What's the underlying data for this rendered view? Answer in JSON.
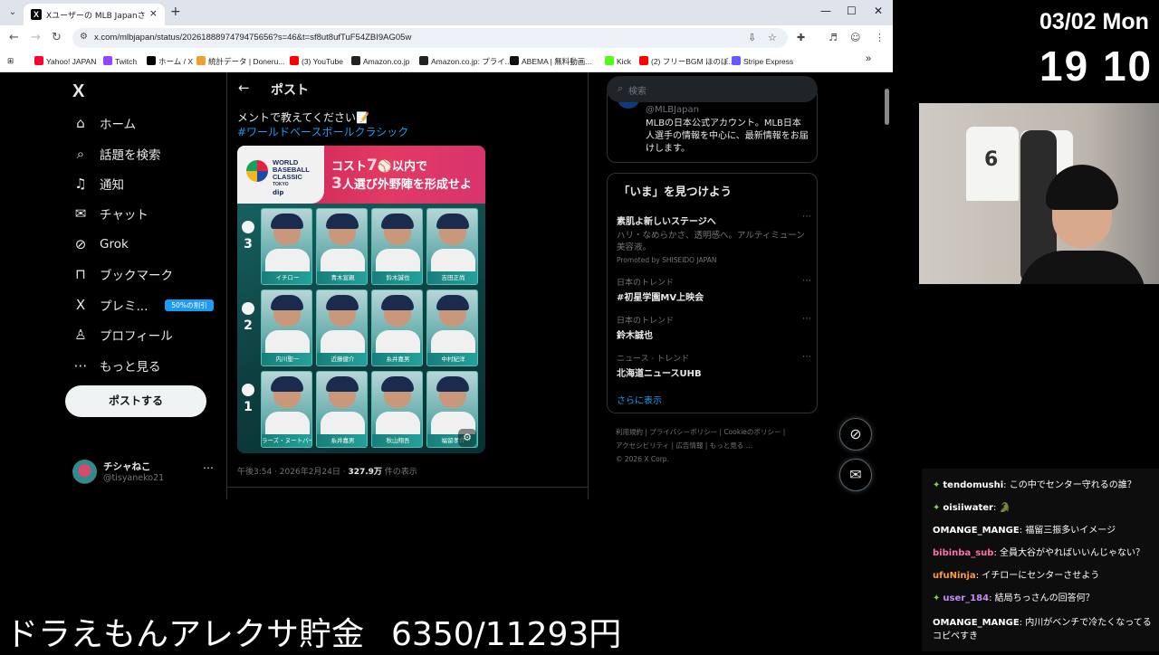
{
  "browser": {
    "tab_title": "Xユーザーの MLB Japanさん: 「誰を",
    "url": "x.com/mlbjapan/status/2026188897479475656?s=46&t=sf8ut8ufTuF54ZBI9AG05w",
    "bookmarks": [
      {
        "label": "Yahoo! JAPAN",
        "color": "#ff0033"
      },
      {
        "label": "Twitch",
        "color": "#9146ff"
      },
      {
        "label": "ホーム / X",
        "color": "#000000"
      },
      {
        "label": "統計データ | Doneru...",
        "color": "#f0a030"
      },
      {
        "label": "(3) YouTube",
        "color": "#ff0000"
      },
      {
        "label": "Amazon.co.jp",
        "color": "#222222"
      },
      {
        "label": "Amazon.co.jp: プライ...",
        "color": "#222222"
      },
      {
        "label": "ABEMA | 無料動画...",
        "color": "#111111"
      },
      {
        "label": "Kick",
        "color": "#53fc18"
      },
      {
        "label": "(2) フリーBGM ほのぼ...",
        "color": "#ff0000"
      },
      {
        "label": "Stripe Express",
        "color": "#635bff"
      }
    ]
  },
  "nav": {
    "logo": "X",
    "items": [
      {
        "icon": "⌂",
        "label": "ホーム"
      },
      {
        "icon": "⌕",
        "label": "話題を検索"
      },
      {
        "icon": "♫",
        "label": "通知"
      },
      {
        "icon": "✉",
        "label": "チャット"
      },
      {
        "icon": "⊘",
        "label": "Grok"
      },
      {
        "icon": "⊓",
        "label": "ブックマーク"
      },
      {
        "icon": "X",
        "label": "プレミ..."
      },
      {
        "icon": "♙",
        "label": "プロフィール"
      },
      {
        "icon": "⋯",
        "label": "もっと見る"
      }
    ],
    "premium_badge": "50%の割引",
    "post_button": "ポストする",
    "account_name": "チシャねこ",
    "account_handle": "@tisyaneko21"
  },
  "post": {
    "header": "ポスト",
    "text_fragment": "メントで教えてください📝",
    "hashtag": "#ワールドベースボールクラシック",
    "meta_time": "午後3:54 · 2026年2月24日 · ",
    "meta_views": "327.9万",
    "meta_views_suffix": " 件の表示",
    "image": {
      "logo_line1": "WORLD",
      "logo_line2": "BASEBALL",
      "logo_line3": "CLASSIC",
      "logo_city": "TOKYO",
      "sponsor": "dip",
      "headline1_a": "コスト",
      "headline1_b": "7",
      "headline1_c": "以内で",
      "headline2_a": "3",
      "headline2_b": "人選び外野陣を形成せよ",
      "rows": [
        {
          "cost": "3",
          "players": [
            "イチロー",
            "青木宣親",
            "鈴木誠也",
            "吉田正尚"
          ]
        },
        {
          "cost": "2",
          "players": [
            "内川聖一",
            "近藤健介",
            "糸井嘉男",
            "中村紀洋"
          ]
        },
        {
          "cost": "1",
          "players": [
            "ラーズ・ヌートバー",
            "糸井嘉男",
            "秋山翔吾",
            "福留孝介"
          ]
        }
      ]
    }
  },
  "right": {
    "search_placeholder": "検索",
    "profile_handle": "@MLBJapan",
    "profile_desc": "MLBの日本公式アカウント。MLB日本人選手の情報を中心に、最新情報をお届けします。",
    "trends_title": "「いま」を見つけよう",
    "trends": [
      {
        "sub": "",
        "title": "素肌よ新しいステージへ",
        "extra": "ハリ・なめらかさ、透明感へ。アルティミューン美容液。",
        "promo": "Promoted by SHISEIDO JAPAN"
      },
      {
        "sub": "日本のトレンド",
        "title": "#初星学園MV上映会"
      },
      {
        "sub": "日本のトレンド",
        "title": "鈴木誠也"
      },
      {
        "sub": "ニュース · トレンド",
        "title": "北海道ニュースUHB"
      }
    ],
    "show_more": "さらに表示",
    "footer_line1": "利用規約 | プライバシーポリシー | Cookieのポリシー |",
    "footer_line2": "アクセシビリティ | 広告情報 | もっと見る …",
    "footer_line3": "© 2026 X Corp."
  },
  "overlay": {
    "date": "03/02 Mon",
    "time": "19 10",
    "banner_text": "ドラえもんアレクサ貯金",
    "banner_amount": "6350/11293円",
    "chat": [
      {
        "user": "tendomushi",
        "msg": "この中でセンター守れるの誰？",
        "color": "#ffffff",
        "gem": true
      },
      {
        "user": "oisiiwater",
        "msg": "🐊",
        "color": "#ffffff",
        "gem": true
      },
      {
        "user": "OMANGE_MANGE",
        "msg": "福留三振多いイメージ",
        "color": "#ffffff",
        "gem": false
      },
      {
        "user": "bibinba_sub",
        "msg": "全員大谷がやればいいんじゃない？",
        "color": "#ff6fa8",
        "gem": false
      },
      {
        "user": "ufuNinja",
        "msg": "イチローにセンターさせよう",
        "color": "#ff9a3c",
        "gem": false
      },
      {
        "user": "user_184",
        "msg": "結局ちっさんの回答何？",
        "color": "#c58cff",
        "gem": true
      },
      {
        "user": "OMANGE_MANGE",
        "msg": "内川がベンチで冷たくなってるコピペすき",
        "color": "#ffffff",
        "gem": false
      }
    ]
  }
}
